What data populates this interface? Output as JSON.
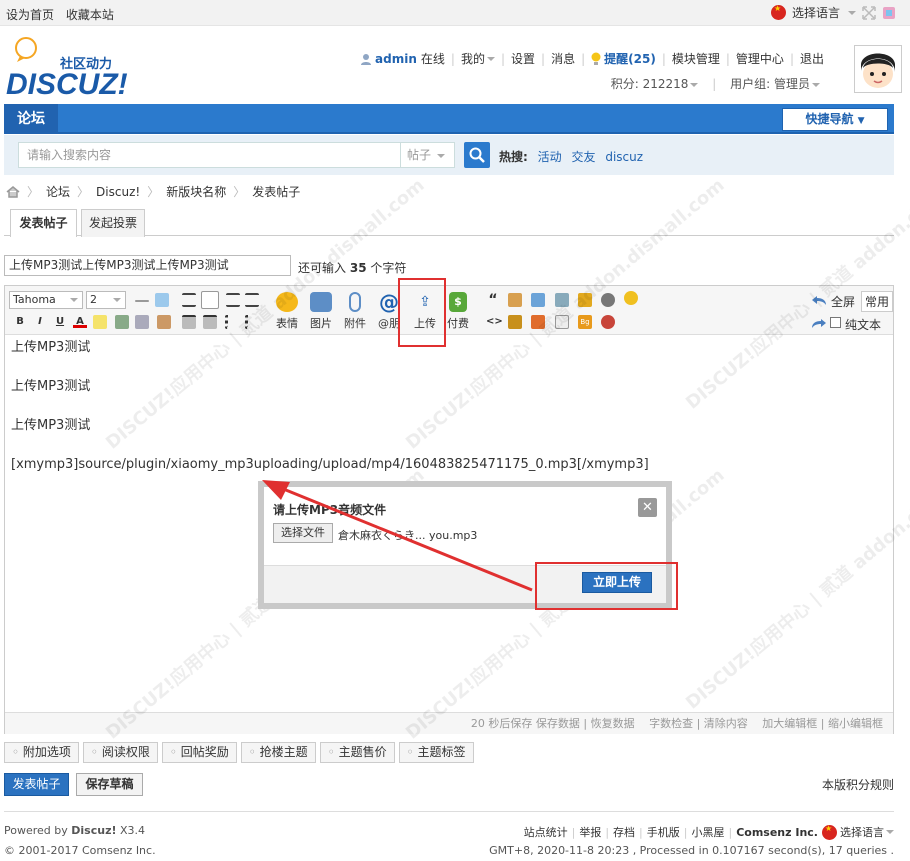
{
  "topbar": {
    "set_home": "设为首页",
    "bookmark": "收藏本站",
    "language": "选择语言"
  },
  "brand": {
    "logo_text": "DISCUZ!",
    "slogan": "社区动力"
  },
  "user": {
    "name": "admin",
    "status": "在线",
    "my": "我的",
    "settings": "设置",
    "messages": "消息",
    "reminders": "提醒(25)",
    "module_mgmt": "模块管理",
    "admin_center": "管理中心",
    "logout": "退出",
    "points_label": "积分: 212218",
    "group": "用户组: 管理员"
  },
  "nav": {
    "forum": "论坛",
    "quick_nav": "快捷导航"
  },
  "search": {
    "placeholder": "请输入搜索内容",
    "type": "帖子",
    "hot_label": "热搜:",
    "hot_terms": [
      "活动",
      "交友",
      "discuz"
    ]
  },
  "breadcrumb": [
    "论坛",
    "Discuz!",
    "新版块名称",
    "发表帖子"
  ],
  "post_tabs": [
    "发表帖子",
    "发起投票"
  ],
  "subject": {
    "value": "上传MP3测试上传MP3测试上传MP3测试",
    "remain_prefix": "还可输入",
    "remain_count": "35",
    "remain_suffix": "个字符"
  },
  "toolbar": {
    "font": "Tahoma",
    "size": "2",
    "big_buttons": [
      "表情",
      "图片",
      "附件",
      "@朋",
      "上传",
      "付费"
    ],
    "fullscreen": "全屏",
    "common": "常用",
    "plain_text": "纯文本"
  },
  "content": {
    "lines": [
      "上传MP3测试",
      "上传MP3测试",
      "上传MP3测试",
      "[xmymp3]source/plugin/xiaomy_mp3uploading/upload/mp4/160483825471175_0.mp3[/xmymp3]"
    ]
  },
  "statusbar": "20 秒后保存 保存数据 | 恢复数据　 字数检查 | 清除内容　 加大编辑框 | 缩小编辑框",
  "dialog": {
    "title": "请上传MP3音频文件",
    "choose_file": "选择文件",
    "file_name": "倉木麻衣くらき... you.mp3",
    "upload": "立即上传"
  },
  "watermark": "DISCUZ!应用中心 | 贰道 addon.dismall.com",
  "options": [
    "附加选项",
    "阅读权限",
    "回帖奖励",
    "抢楼主题",
    "主题售价",
    "主题标签"
  ],
  "submit": "发表帖子",
  "save_draft": "保存草稿",
  "rules": "本版积分规则",
  "footer": {
    "powered": "Powered by",
    "brand": "Discuz!",
    "version": "X3.4",
    "copyright": "© 2001-2017 Comsenz Inc.",
    "links": [
      "站点统计",
      "举报",
      "存档",
      "手机版",
      "小黑屋"
    ],
    "company": "Comsenz Inc.",
    "language": "选择语言",
    "stats": "GMT+8, 2020-11-8 20:23 , Processed in 0.107167 second(s), 17 queries ."
  },
  "colors": {
    "nav_blue": "#2b7acd",
    "accent_red": "#e03030",
    "button_blue": "#2b72c0"
  }
}
